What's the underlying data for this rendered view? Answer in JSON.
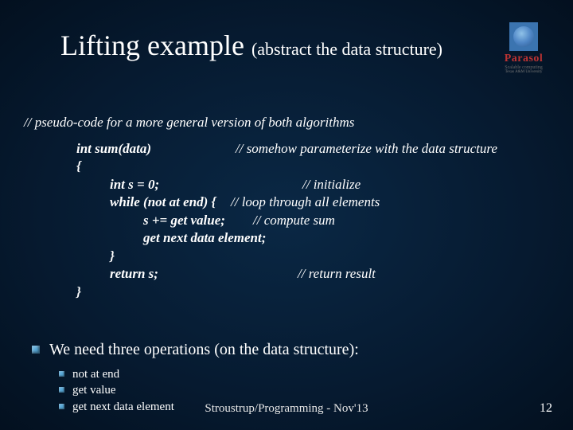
{
  "logo": {
    "brand": "Parasol",
    "tag1": "Scalable computing",
    "tag2": "Texas A&M University"
  },
  "title": {
    "main": "Lifting example",
    "sub": "(abstract the data structure)"
  },
  "pseudo_intro": "// pseudo-code  for a more general version of  both algorithms",
  "code": {
    "sig": "int sum(data)",
    "sig_comment": "// somehow parameterize with the data structure",
    "open": "{",
    "l1": "int s = 0;",
    "c1": "// initialize",
    "l2": "while (not at end) {",
    "c2": "// loop through all elements",
    "l3": "s += get value;",
    "c3": "// compute sum",
    "l4": "get next data element;",
    "l5": "}",
    "l6": "return s;",
    "c6": "// return result",
    "close": "}"
  },
  "need": "We need three operations (on the data structure):",
  "ops": [
    "not at end",
    "get value",
    "get next data element"
  ],
  "footer": "Stroustrup/Programming - Nov'13",
  "page": "12"
}
